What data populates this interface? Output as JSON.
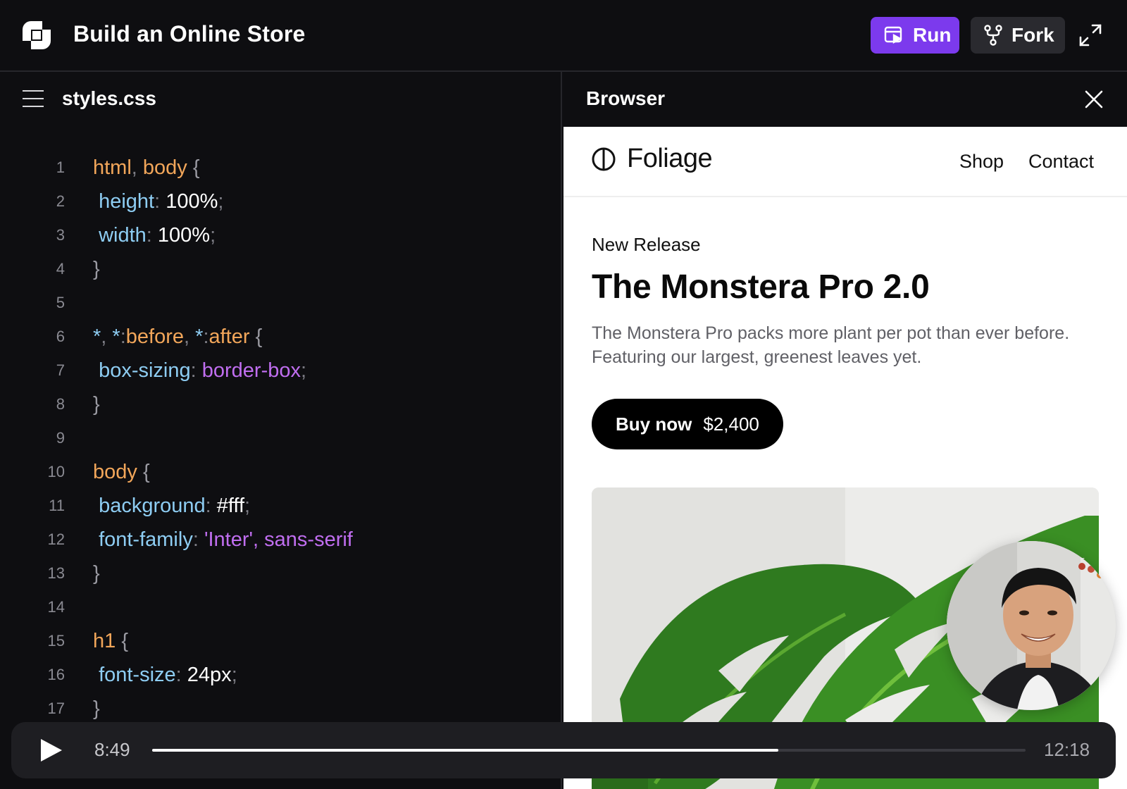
{
  "app": {
    "title": "Build an Online Store",
    "run_label": "Run",
    "fork_label": "Fork",
    "accent_color": "#7c3aed"
  },
  "editor": {
    "file_name": "styles.css",
    "lines": [
      {
        "n": "1",
        "parts": [
          [
            "sel",
            "html"
          ],
          [
            "pun",
            ", "
          ],
          [
            "sel",
            "body"
          ],
          [
            "br",
            " {"
          ]
        ]
      },
      {
        "n": "2",
        "parts": [
          [
            "sp",
            " "
          ],
          [
            "prop",
            "height"
          ],
          [
            "pun",
            ": "
          ],
          [
            "val",
            "100%"
          ],
          [
            "pun",
            ";"
          ]
        ]
      },
      {
        "n": "3",
        "parts": [
          [
            "sp",
            " "
          ],
          [
            "prop",
            "width"
          ],
          [
            "pun",
            ": "
          ],
          [
            "val",
            "100%"
          ],
          [
            "pun",
            ";"
          ]
        ]
      },
      {
        "n": "4",
        "parts": [
          [
            "br",
            "}"
          ]
        ]
      },
      {
        "n": "5",
        "parts": []
      },
      {
        "n": "6",
        "parts": [
          [
            "prop",
            "*"
          ],
          [
            "pun",
            ", "
          ],
          [
            "prop",
            "*"
          ],
          [
            "pun",
            ":"
          ],
          [
            "sel",
            "before"
          ],
          [
            "pun",
            ", "
          ],
          [
            "prop",
            "*"
          ],
          [
            "pun",
            ":"
          ],
          [
            "sel",
            "after"
          ],
          [
            "br",
            " {"
          ]
        ]
      },
      {
        "n": "7",
        "parts": [
          [
            "sp",
            " "
          ],
          [
            "prop",
            "box-sizing"
          ],
          [
            "pun",
            ": "
          ],
          [
            "kw",
            "border-box"
          ],
          [
            "pun",
            ";"
          ]
        ]
      },
      {
        "n": "8",
        "parts": [
          [
            "br",
            "}"
          ]
        ]
      },
      {
        "n": "9",
        "parts": []
      },
      {
        "n": "10",
        "parts": [
          [
            "sel",
            "body"
          ],
          [
            "br",
            " {"
          ]
        ]
      },
      {
        "n": "11",
        "parts": [
          [
            "sp",
            " "
          ],
          [
            "prop",
            "background"
          ],
          [
            "pun",
            ": "
          ],
          [
            "val",
            "#fff"
          ],
          [
            "pun",
            ";"
          ]
        ]
      },
      {
        "n": "12",
        "parts": [
          [
            "sp",
            " "
          ],
          [
            "prop",
            "font-family"
          ],
          [
            "pun",
            ": "
          ],
          [
            "kw",
            "'Inter', sans-serif"
          ]
        ]
      },
      {
        "n": "13",
        "parts": [
          [
            "br",
            "}"
          ]
        ]
      },
      {
        "n": "14",
        "parts": []
      },
      {
        "n": "15",
        "parts": [
          [
            "sel",
            "h1"
          ],
          [
            "br",
            " {"
          ]
        ]
      },
      {
        "n": "16",
        "parts": [
          [
            "sp",
            " "
          ],
          [
            "prop",
            "font-size"
          ],
          [
            "pun",
            ": "
          ],
          [
            "val",
            "24px"
          ],
          [
            "pun",
            ";"
          ]
        ]
      },
      {
        "n": "17",
        "parts": [
          [
            "br",
            "}"
          ]
        ]
      }
    ]
  },
  "browser": {
    "title": "Browser",
    "site": {
      "brand": "Foliage",
      "nav": [
        "Shop",
        "Contact"
      ],
      "eyebrow": "New Release",
      "headline": "The Monstera Pro 2.0",
      "description": "The Monstera Pro packs more plant per pot than ever before. Featuring our largest, greenest leaves yet.",
      "buy_label": "Buy now",
      "price": "$2,400"
    }
  },
  "player": {
    "current_time": "8:49",
    "total_time": "12:18",
    "progress": 0.717
  }
}
